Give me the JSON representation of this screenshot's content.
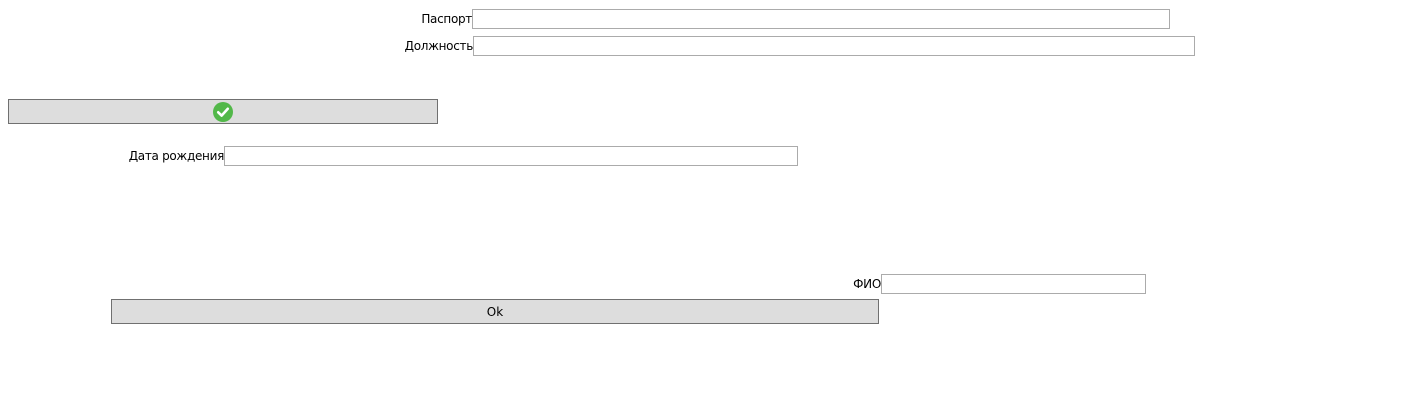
{
  "form": {
    "passport": {
      "label": "Паспорт",
      "value": ""
    },
    "position": {
      "label": "Должность",
      "value": ""
    },
    "birth_date": {
      "label": "Дата рождения",
      "value": ""
    },
    "full_name": {
      "label": "ФИО",
      "value": ""
    }
  },
  "buttons": {
    "confirm": {
      "icon": "check-circle-icon",
      "icon_color": "#52b849"
    },
    "ok": {
      "label": "Ok"
    }
  }
}
